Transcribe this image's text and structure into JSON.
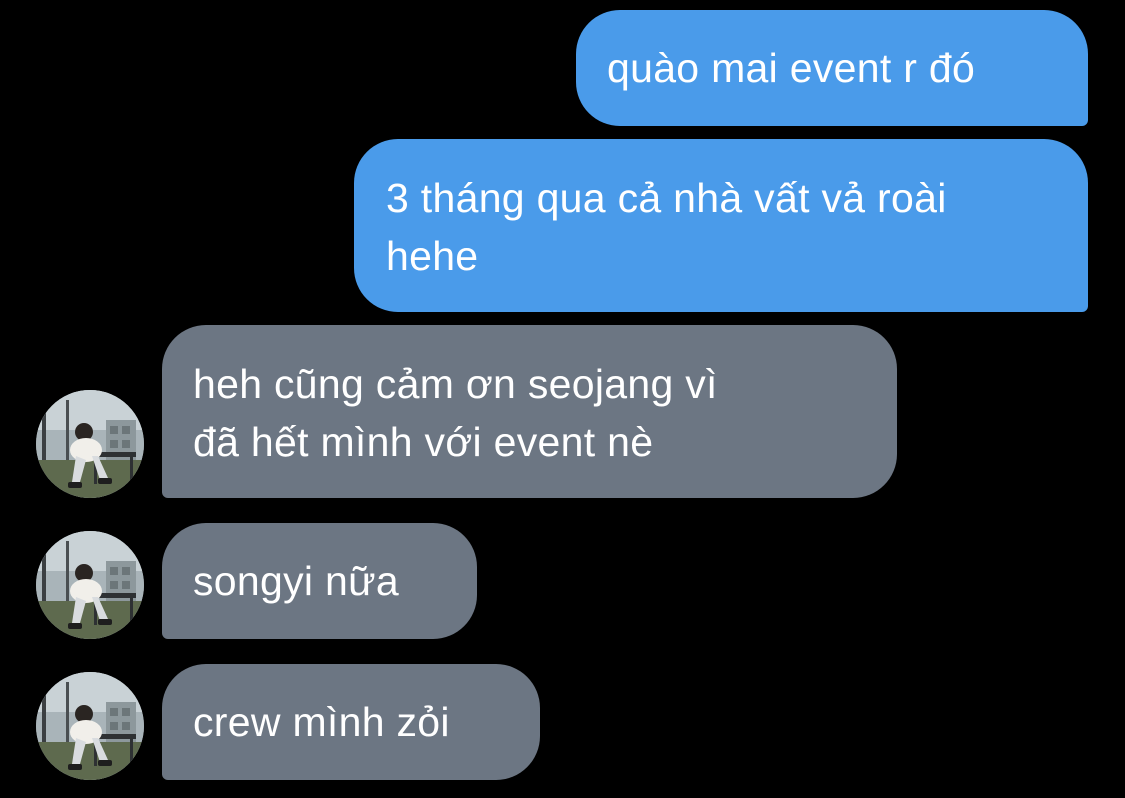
{
  "conversation": {
    "sent": [
      {
        "lines": [
          "quào mai event r đó"
        ]
      },
      {
        "lines": [
          "3 tháng qua cả nhà vất vả roài",
          "hehe"
        ]
      }
    ],
    "received": [
      {
        "lines": [
          "heh cũng cảm ơn seojang vì",
          "đã hết mình với event nè"
        ]
      },
      {
        "lines": [
          "songyi nữa"
        ]
      },
      {
        "lines": [
          "crew mình zỏi"
        ]
      }
    ]
  },
  "colors": {
    "background": "#000000",
    "sent_bubble": "#4a9bea",
    "received_bubble": "#6c7683",
    "text": "#ffffff"
  },
  "icons": {
    "avatar": "contact-avatar-photo"
  }
}
